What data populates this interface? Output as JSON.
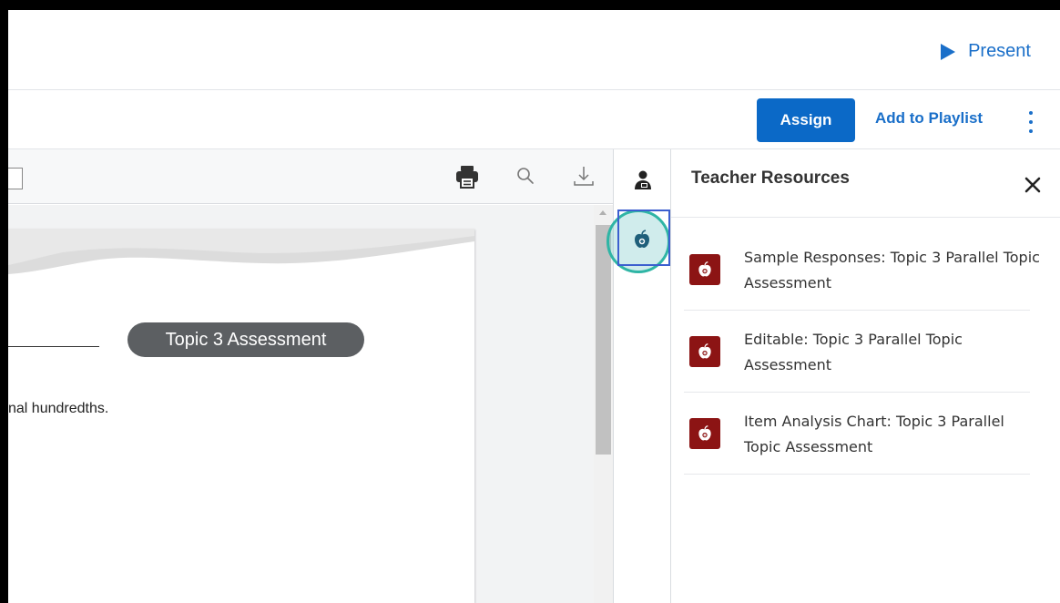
{
  "header": {
    "present_label": "Present"
  },
  "actions": {
    "assign_label": "Assign",
    "playlist_label": "Add to Playlist"
  },
  "document": {
    "pill_title": "Topic 3 Assessment",
    "body_text": "nal hundredths."
  },
  "panel": {
    "title": "Teacher Resources",
    "items": [
      {
        "label": "Sample Responses: Topic 3 Parallel Topic Assessment"
      },
      {
        "label": "Editable: Topic 3 Parallel Topic Assessment"
      },
      {
        "label": "Item Analysis Chart: Topic 3 Parallel Topic Assessment"
      }
    ]
  },
  "colors": {
    "accent": "#0b69c7",
    "link": "#1a6fc9",
    "resource_icon_bg": "#8c1414",
    "highlight_ring": "#2fb5a5"
  },
  "icons": {
    "present": "play-icon",
    "more": "kebab-icon",
    "print": "printer-icon",
    "search": "search-icon",
    "download": "download-icon",
    "teacher": "teacher-icon",
    "resources": "apple-icon",
    "close": "close-icon",
    "resource_item": "apple-icon"
  }
}
